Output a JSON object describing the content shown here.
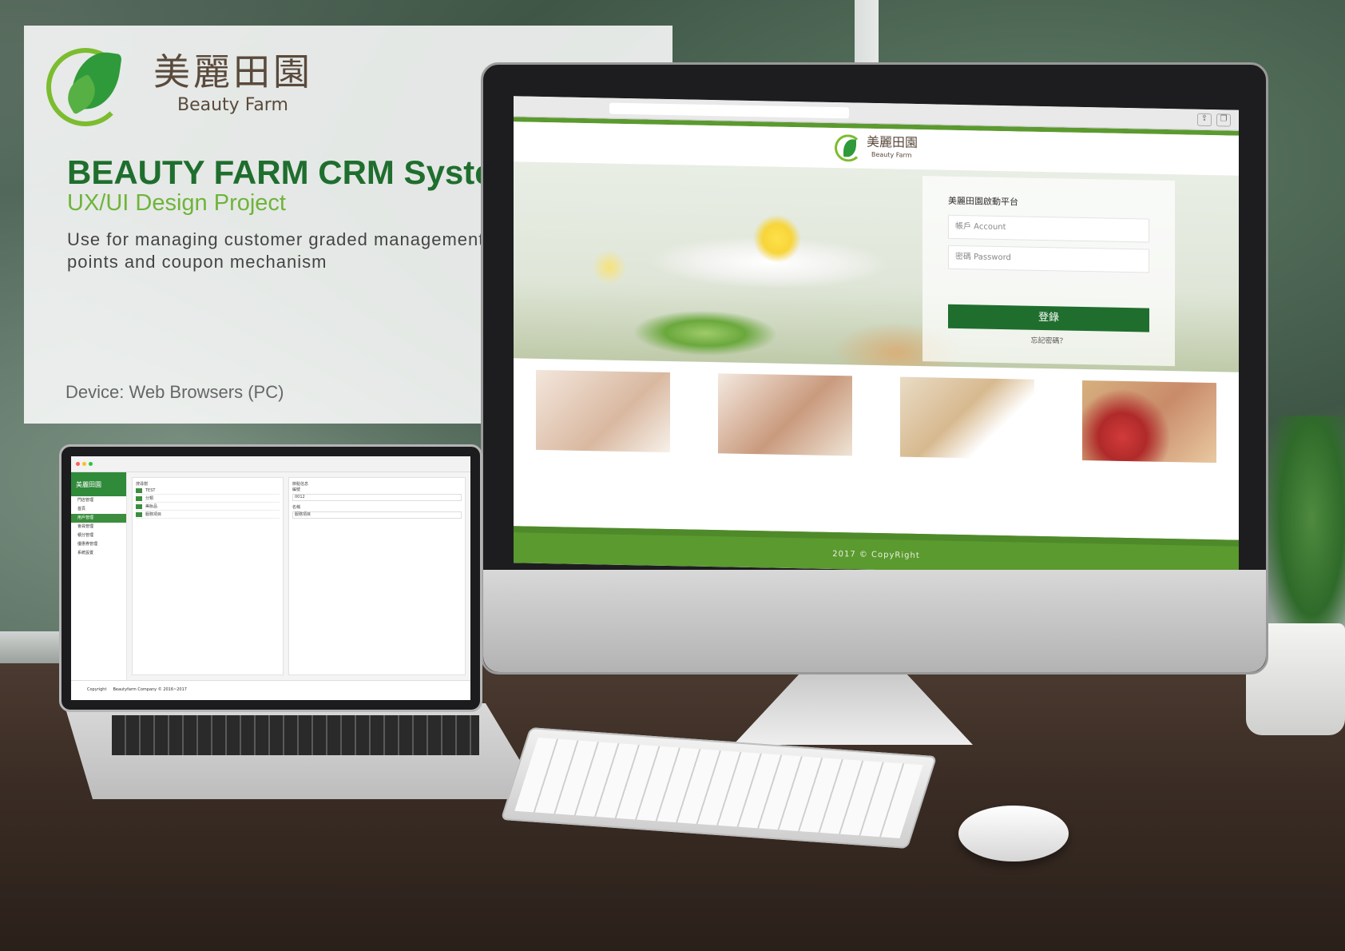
{
  "intro": {
    "logo_cn": "美麗田園",
    "logo_en": "Beauty Farm",
    "title": "BEAUTY FARM CRM System",
    "subtitle": "UX/UI Design Project",
    "description": "Use for managing customer graded management, setting points and coupon mechanism",
    "device": "Device: Web Browsers (PC)"
  },
  "imac_site": {
    "logo_cn": "美麗田園",
    "logo_en": "Beauty Farm",
    "login_title": "美麗田園啟動平台",
    "account_placeholder": "帳戶 Account",
    "password_placeholder": "密碼 Password",
    "login_button": "登錄",
    "forgot": "忘記密碼？",
    "footer": "2017 © CopyRight",
    "colors": {
      "primary": "#1f6e2e",
      "accent": "#5b9a2f"
    }
  },
  "laptop_app": {
    "brand": "美麗田園",
    "side_items": [
      "門店管理",
      "首頁",
      "用戶管理",
      "會員管理",
      "積分管理",
      "優惠券管理",
      "系統設置"
    ],
    "tree_header": "搜尋樹",
    "tree_items": [
      "TEST",
      "分類",
      "美妝品",
      "服務項目"
    ],
    "detail_header": "節點信息",
    "field1_label": "編號",
    "field1_value": "0012",
    "field2_label": "名稱",
    "field2_value": "服務項目",
    "footer_copy": "Copyright",
    "footer_company": "Beautyfarm Company © 2016~2017"
  }
}
